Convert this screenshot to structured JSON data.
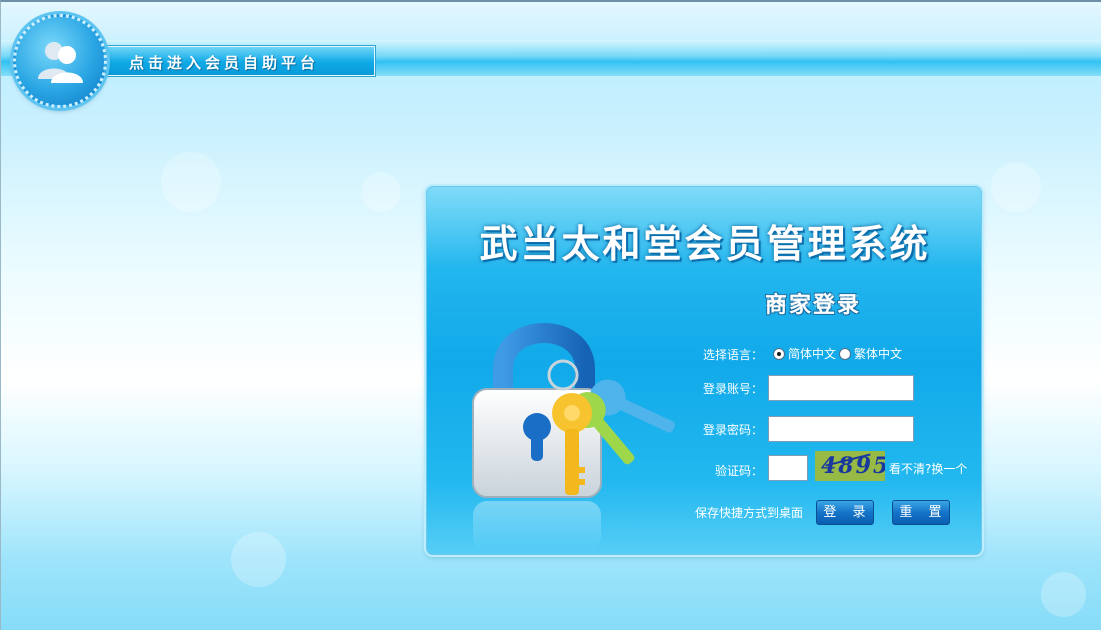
{
  "header": {
    "label": "点击进入会员自助平台",
    "icon": "users-icon"
  },
  "login": {
    "system_title": "武当太和堂会员管理系统",
    "subtitle": "商家登录",
    "language_label": "选择语言：",
    "lang_simplified": "简体中文",
    "lang_traditional": "繁体中文",
    "selected_language": "简体中文",
    "account_label": "登录账号：",
    "account_value": "",
    "password_label": "登录密码：",
    "password_value": "",
    "captcha_label": "验证码：",
    "captcha_value": "",
    "captcha_text": "4895",
    "captcha_refresh": "看不清?换一个",
    "save_shortcut": "保存快捷方式到桌面",
    "login_button": "登 录",
    "reset_button": "重 置"
  },
  "colors": {
    "panel": "#11a9ea",
    "button": "#1574c8",
    "captcha_bg": "#97b946"
  }
}
